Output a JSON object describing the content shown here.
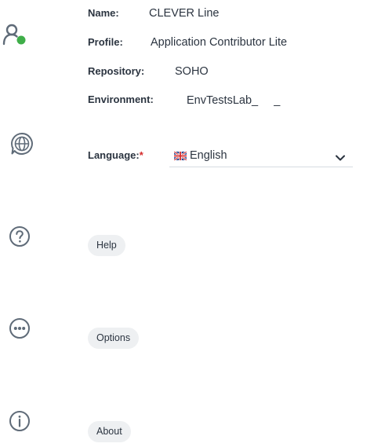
{
  "user": {
    "name_label": "Name:",
    "name_value": "CLEVER Line",
    "profile_label": "Profile:",
    "profile_value": "Application Contributor Lite",
    "repository_label": "Repository:",
    "repository_value": "SOHO",
    "environment_label": "Environment:",
    "environment_value": "EnvTestsLab_     _",
    "status_color": "#3fae49",
    "icon": "user-status-icon"
  },
  "language": {
    "label": "Language:",
    "required_mark": "*",
    "selected": "English",
    "flag": "uk-flag",
    "icon": "globe-icon",
    "dropdown_icon": "chevron-down-icon"
  },
  "help": {
    "label": "Help",
    "icon": "question-circle-icon"
  },
  "options": {
    "label": "Options",
    "icon": "ellipsis-circle-icon"
  },
  "about": {
    "label": "About",
    "icon": "info-circle-icon"
  },
  "colors": {
    "icon_gray": "#5f6b78",
    "pill_bg": "#eef0f2",
    "required": "#d52b2b"
  }
}
